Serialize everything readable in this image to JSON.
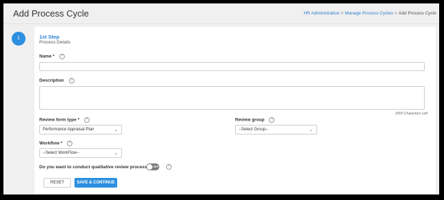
{
  "page": {
    "title": "Add Process Cycle"
  },
  "breadcrumb": [
    {
      "label": "HR Administration",
      "link": true
    },
    {
      "label": "Manage Process Cycles",
      "link": true
    },
    {
      "label": "Add Process Cycle",
      "link": false
    }
  ],
  "step": {
    "number": "1",
    "title": "1st Step",
    "subtitle": "Process Details"
  },
  "form": {
    "name": {
      "label": "Name",
      "required": "*",
      "value": ""
    },
    "description": {
      "label": "Description",
      "value": "",
      "counter": "2000 Characters Left"
    },
    "review_form_type": {
      "label": "Review form type",
      "required": "*",
      "value": "Performance Appraisal Plan"
    },
    "review_group": {
      "label": "Review group",
      "value": "--Select Group--"
    },
    "workflow": {
      "label": "Workflow",
      "required": "*",
      "value": "--Select WorkFlow--"
    },
    "qualitative": {
      "question": "Do you want to conduct qualitative review process?",
      "toggle_text": "OFF",
      "toggle_state": "off"
    }
  },
  "buttons": {
    "reset": "RESET",
    "save": "SAVE & CONTINUE"
  },
  "colors": {
    "accent": "#2c8fe0",
    "link": "#2f7fd0",
    "toggle_off": "#7d7d7d"
  },
  "icons": {
    "help": "help-circle-icon",
    "chevron": "chevron-down-icon"
  }
}
